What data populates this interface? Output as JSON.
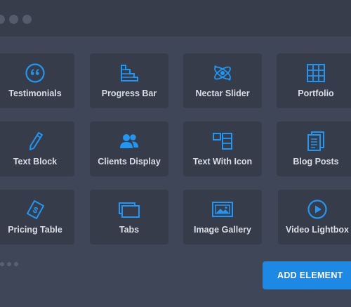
{
  "accent_color": "#1e88e5",
  "elements": [
    {
      "label": "Testimonials",
      "icon": "quote-icon"
    },
    {
      "label": "Progress Bar",
      "icon": "stairs-icon"
    },
    {
      "label": "Nectar Slider",
      "icon": "atom-icon"
    },
    {
      "label": "Portfolio",
      "icon": "grid-icon"
    },
    {
      "label": "Text Block",
      "icon": "pencil-icon"
    },
    {
      "label": "Clients Display",
      "icon": "users-icon"
    },
    {
      "label": "Text With Icon",
      "icon": "text-icon-layout-icon"
    },
    {
      "label": "Blog Posts",
      "icon": "documents-icon"
    },
    {
      "label": "Pricing Table",
      "icon": "price-tag-icon"
    },
    {
      "label": "Tabs",
      "icon": "tabs-icon"
    },
    {
      "label": "Image Gallery",
      "icon": "image-icon"
    },
    {
      "label": "Video Lightbox",
      "icon": "play-icon"
    }
  ],
  "add_button_label": "ADD ELEMENT"
}
